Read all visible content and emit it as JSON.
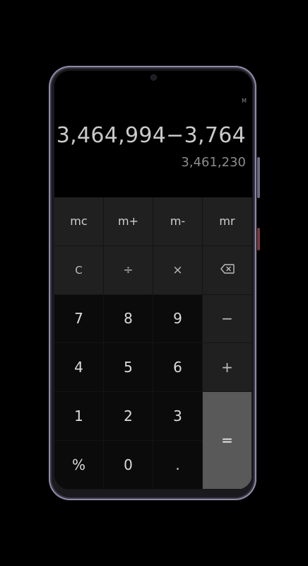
{
  "display": {
    "memory_indicator": "M",
    "expression": "3,464,994−3,764",
    "result": "3,461,230"
  },
  "keys": {
    "mc": "mc",
    "m_plus": "m+",
    "m_minus": "m-",
    "mr": "mr",
    "clear": "C",
    "divide": "÷",
    "multiply": "×",
    "backspace": "⌫",
    "seven": "7",
    "eight": "8",
    "nine": "9",
    "minus": "−",
    "four": "4",
    "five": "5",
    "six": "6",
    "plus": "+",
    "one": "1",
    "two": "2",
    "three": "3",
    "equals": "=",
    "percent": "%",
    "zero": "0",
    "decimal": "."
  },
  "colors": {
    "background": "#000000",
    "function_key_bg": "#202020",
    "digit_key_bg": "#0b0b0b",
    "equals_key_bg": "#595959",
    "frame": "#8f8aa6"
  }
}
